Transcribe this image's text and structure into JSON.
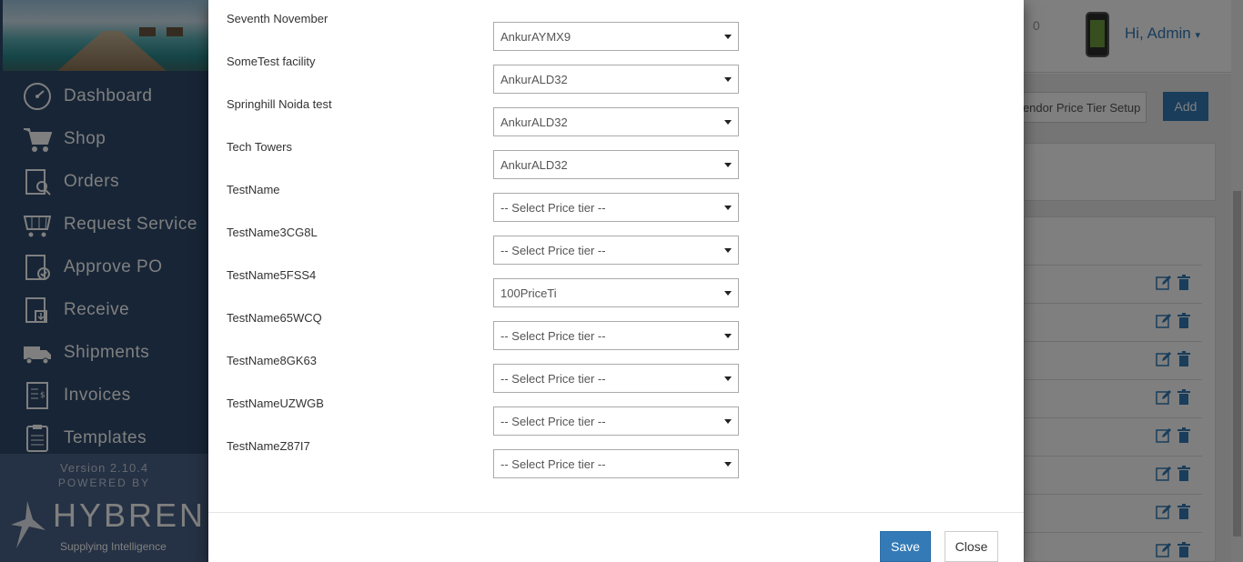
{
  "sidebar": {
    "items": [
      {
        "label": "Dashboard",
        "icon": "dashboard-icon"
      },
      {
        "label": "Shop",
        "icon": "cart-icon"
      },
      {
        "label": "Orders",
        "icon": "orders-icon"
      },
      {
        "label": "Request Service",
        "icon": "request-service-icon"
      },
      {
        "label": "Approve PO",
        "icon": "approve-po-icon"
      },
      {
        "label": "Receive",
        "icon": "receive-icon"
      },
      {
        "label": "Shipments",
        "icon": "truck-icon"
      },
      {
        "label": "Invoices",
        "icon": "invoice-icon"
      },
      {
        "label": "Templates",
        "icon": "templates-icon"
      }
    ],
    "version": "Version 2.10.4",
    "powered_by": "POWERED BY",
    "brand": "HYBREN",
    "tagline": "Supplying Intelligence"
  },
  "header": {
    "cart_count": "0",
    "greeting": "Hi, Admin"
  },
  "page": {
    "setup_label": "Vendor Price Tier Setup",
    "add_label": "Add"
  },
  "modal": {
    "rows": [
      {
        "label": "Seventh November",
        "value": "AnkurAYMX9"
      },
      {
        "label": "SomeTest facility",
        "value": "AnkurALD32"
      },
      {
        "label": "Springhill Noida test",
        "value": "AnkurALD32"
      },
      {
        "label": "Tech Towers",
        "value": "AnkurALD32"
      },
      {
        "label": "TestName",
        "value": "-- Select Price tier --"
      },
      {
        "label": "TestName3CG8L",
        "value": "-- Select Price tier --"
      },
      {
        "label": "TestName5FSS4",
        "value": "100PriceTi"
      },
      {
        "label": "TestName65WCQ",
        "value": "-- Select Price tier --"
      },
      {
        "label": "TestName8GK63",
        "value": "-- Select Price tier --"
      },
      {
        "label": "TestNameUZWGB",
        "value": "-- Select Price tier --"
      },
      {
        "label": "TestNameZ87I7",
        "value": "-- Select Price tier --"
      }
    ],
    "save_label": "Save",
    "close_label": "Close"
  },
  "colors": {
    "primary": "#337ab7",
    "sidebar": "#2f4a6d"
  }
}
